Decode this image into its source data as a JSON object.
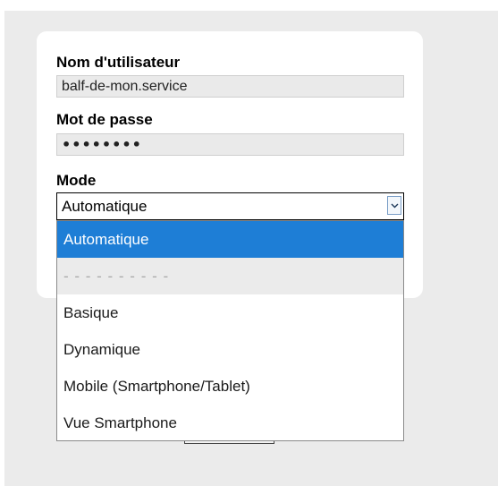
{
  "login": {
    "username_label": "Nom d'utilisateur",
    "username_value": "balf-de-mon.service",
    "password_label": "Mot de passe",
    "password_masked": "••••••••",
    "mode_label": "Mode",
    "mode_selected": "Automatique"
  },
  "mode_dropdown": {
    "options": [
      {
        "label": "Automatique",
        "state": "highlighted"
      },
      {
        "label": "- - - - - - - - - -",
        "state": "disabled"
      },
      {
        "label": "Basique",
        "state": "normal"
      },
      {
        "label": "Dynamique",
        "state": "normal"
      },
      {
        "label": "Mobile (Smartphone/Tablet)",
        "state": "normal"
      },
      {
        "label": "Vue Smartphone",
        "state": "normal"
      }
    ]
  },
  "icons": {
    "select_arrow": "chevron-down-icon"
  },
  "colors": {
    "highlight": "#1e7ed6",
    "background": "#ebebeb",
    "card": "#ffffff",
    "input_fill": "#eaeaea"
  }
}
